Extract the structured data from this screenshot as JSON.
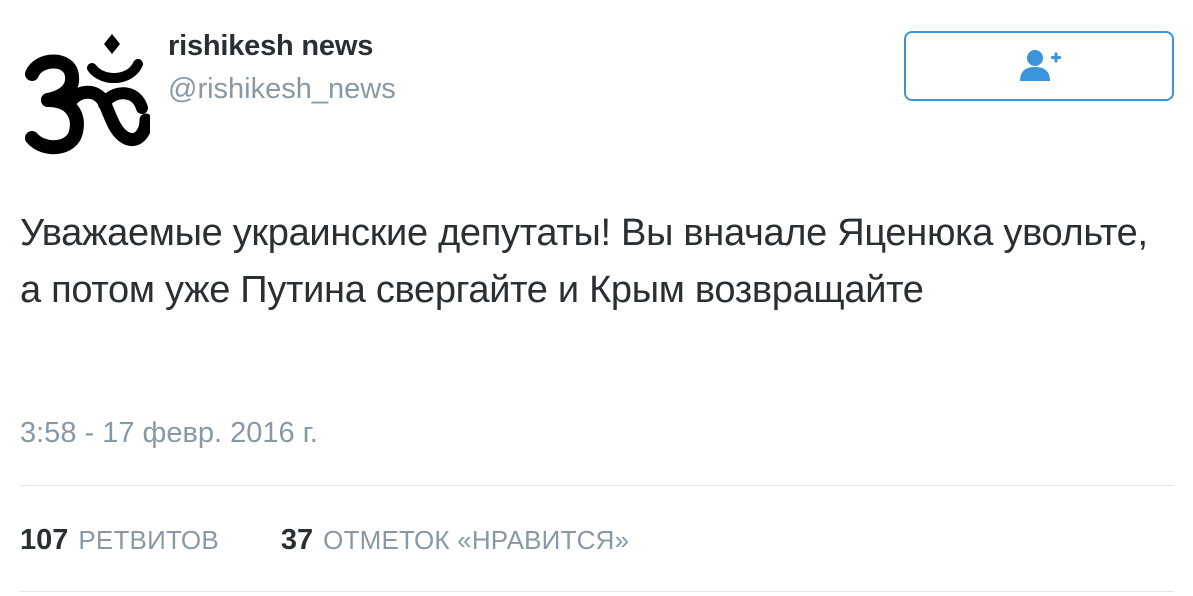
{
  "user": {
    "display_name": "rishikesh news",
    "handle": "@rishikesh_news",
    "avatar_icon": "om-symbol-icon"
  },
  "follow_button": {
    "icon": "follow-user-plus-icon",
    "color": "#3b94d9"
  },
  "tweet": {
    "text": "Уважаемые украинские депутаты! Вы вначале Яценюка увольте, а потом уже Путина свергайте и Крым возвращайте",
    "timestamp": "3:58 - 17 февр. 2016 г."
  },
  "stats": {
    "retweets_count": "107",
    "retweets_label": "РЕТВИТОВ",
    "likes_count": "37",
    "likes_label": "ОТМЕТОК «НРАВИТСЯ»"
  },
  "colors": {
    "text": "#292f33",
    "secondary": "#8899a6",
    "accent": "#3b94d9",
    "divider": "#e1e8ed"
  }
}
